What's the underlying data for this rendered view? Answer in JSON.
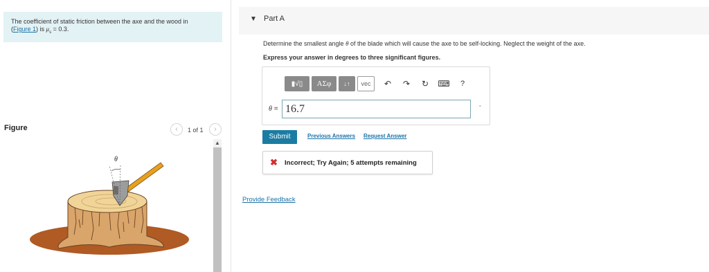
{
  "problem": {
    "text_before": "The coefficient of static friction between the axe and the wood in",
    "figure_link": "Figure 1",
    "text_after_prefix": ") is ",
    "mu_symbol": "μ",
    "mu_sub": "s",
    "text_after_value": " = 0.3."
  },
  "figure": {
    "title": "Figure",
    "count": "1 of 1",
    "prev_glyph": "‹",
    "next_glyph": "›",
    "scroll_up_glyph": "▲",
    "theta_label": "θ"
  },
  "part": {
    "caret": "▼",
    "title": "Part A"
  },
  "question": {
    "before": "Determine the smallest angle ",
    "theta": "θ",
    "after": " of the blade which will cause the axe to be self-locking. Neglect the weight of the axe."
  },
  "instruction": "Express your answer in degrees to three significant figures.",
  "toolbar": {
    "templates": "▮√▯",
    "greek": "ΑΣφ",
    "sort": "↓↑",
    "vec": "vec",
    "undo": "↶",
    "redo": "↷",
    "reset": "↻",
    "keyboard": "⌨",
    "help": "?"
  },
  "answer": {
    "variable": "θ",
    "equals": " =",
    "value": "16.7",
    "unit": "°"
  },
  "buttons": {
    "submit": "Submit",
    "previous_answers": "Previous Answers",
    "request_answer": "Request Answer"
  },
  "feedback": {
    "icon": "✖",
    "message": "Incorrect; Try Again; 5 attempts remaining"
  },
  "provide_feedback": "Provide Feedback"
}
